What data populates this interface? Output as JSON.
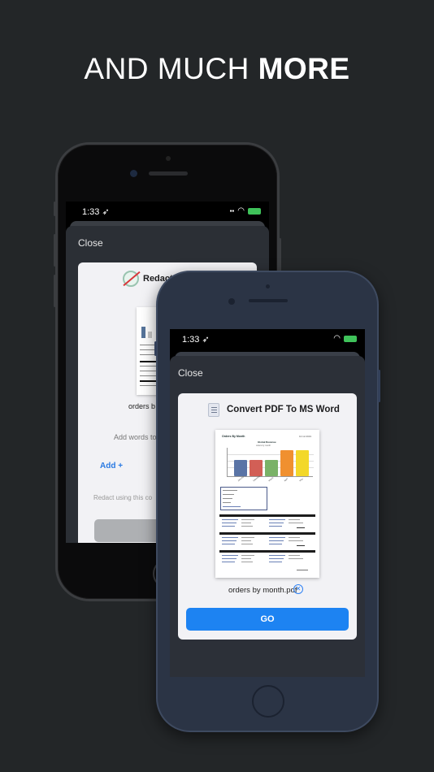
{
  "headline": {
    "regular": "AND MUCH ",
    "bold": "MORE"
  },
  "back_phone": {
    "time": "1:33",
    "close_label": "Close",
    "card_title": "Redact D",
    "file_name": "orders b",
    "add_words_text": "Add words to",
    "add_label": "Add  +",
    "redact_hint": "Redact using this co",
    "colors": {
      "body": "#0b0b0c",
      "sheet": "#2b2f35"
    }
  },
  "front_phone": {
    "time": "1:33",
    "close_label": "Close",
    "card_title": "Convert PDF To MS Word",
    "file_name": "orders by month.pdf",
    "remove_icon": "✕",
    "go_label": "GO",
    "colors": {
      "body": "#2b3445",
      "button": "#1d83f2"
    },
    "document": {
      "title": "Orders By Month",
      "date": "10.12.2019",
      "chart_title": "Global Revenue",
      "chart_subtitle": "orders by month",
      "bar_colors": [
        "#5a74a6",
        "#d25f56",
        "#7ab267",
        "#f0902f",
        "#f3d829"
      ],
      "bar_levels": [
        0.55,
        0.55,
        0.55,
        0.88,
        0.88
      ],
      "bar_labels": [
        "January",
        "February",
        "March",
        "April",
        "May"
      ]
    }
  }
}
